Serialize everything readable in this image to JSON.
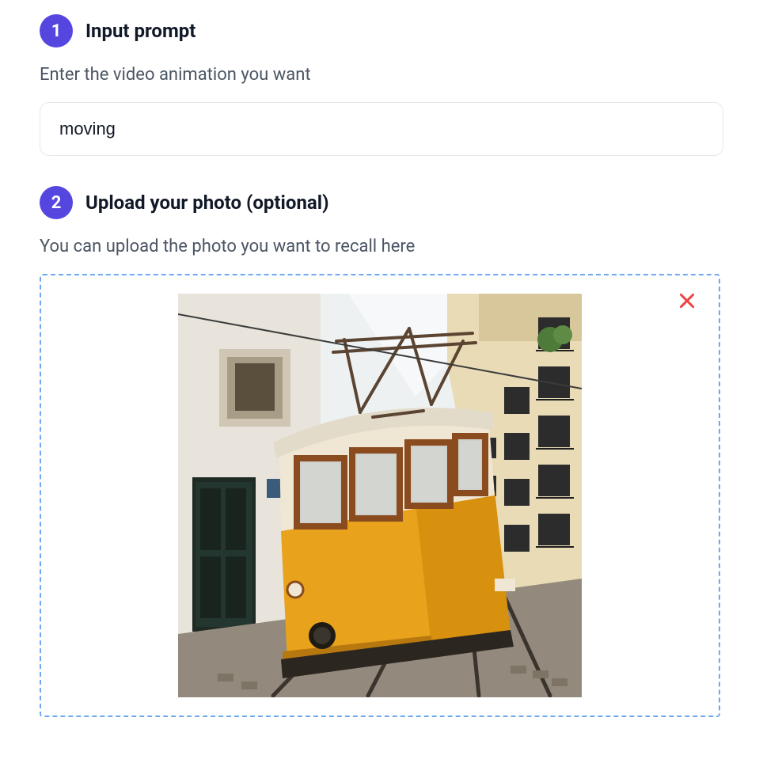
{
  "step1": {
    "number": "1",
    "title": "Input prompt",
    "desc": "Enter the video animation you want",
    "input_value": "moving"
  },
  "step2": {
    "number": "2",
    "title": "Upload your photo (optional)",
    "desc": "You can upload the photo you want to recall here"
  }
}
